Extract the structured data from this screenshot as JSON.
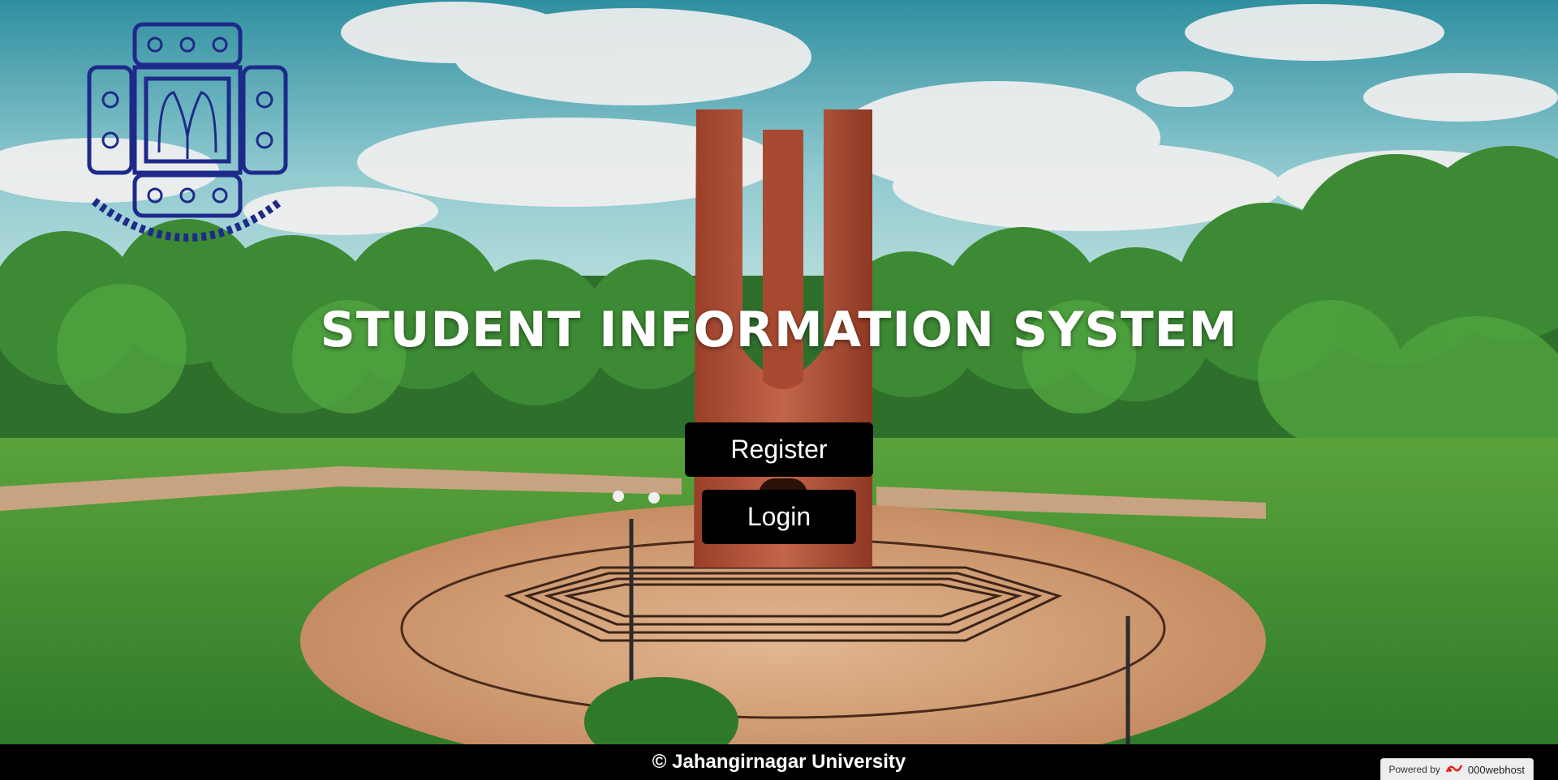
{
  "page": {
    "title": "STUDENT INFORMATION SYSTEM"
  },
  "actions": {
    "register_label": "Register",
    "login_label": "Login"
  },
  "footer": {
    "copyright": "© Jahangirnagar University"
  },
  "badge": {
    "powered_by": "Powered by",
    "brand": "000webhost"
  },
  "colors": {
    "button_bg": "#000000",
    "button_text": "#ffffff",
    "footer_bg": "#000000",
    "logo_ink": "#1e2a8a",
    "monument": "#b5543a"
  },
  "icons": {
    "university_logo": "jahangirnagar-university-emblem",
    "badge_logo": "000webhost-logo"
  }
}
